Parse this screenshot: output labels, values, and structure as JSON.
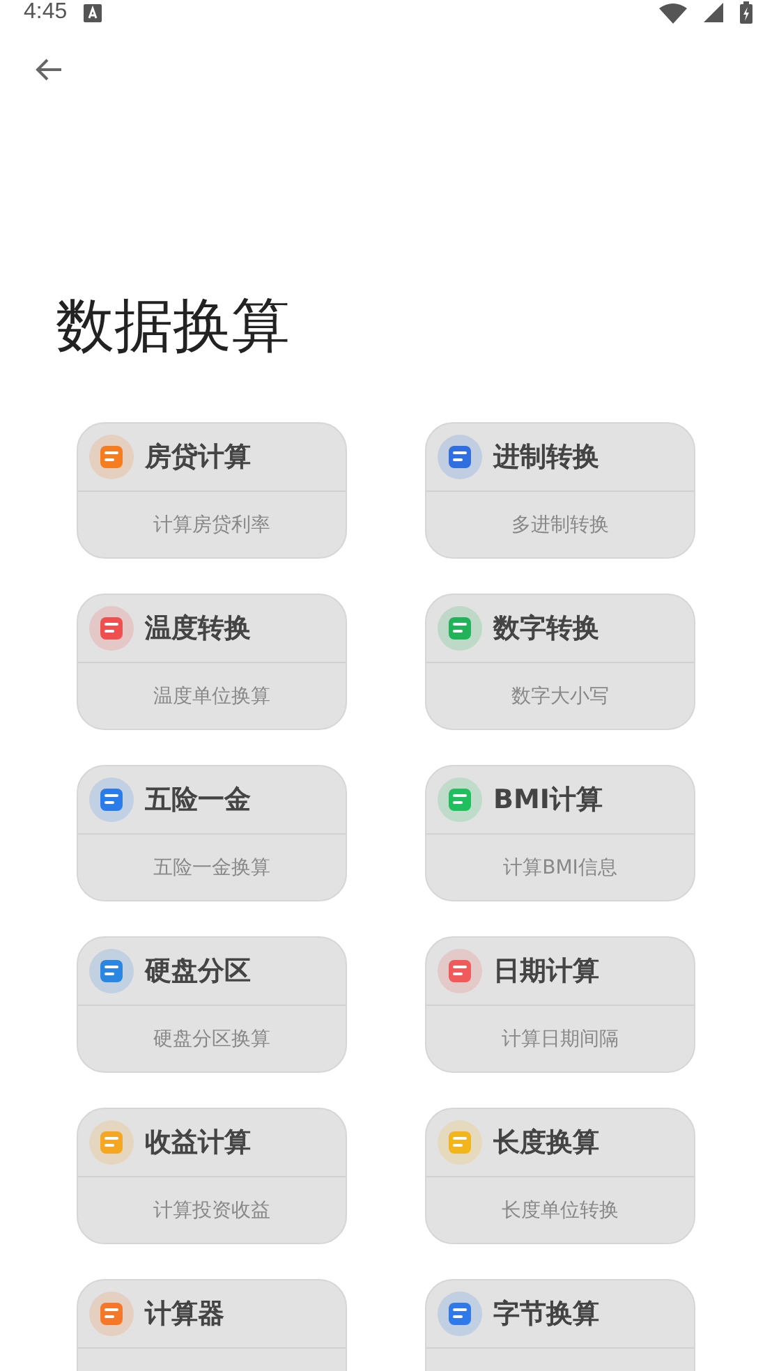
{
  "status_bar": {
    "time": "4:45"
  },
  "title": "数据换算",
  "tools": [
    {
      "name": "房贷计算",
      "description": "计算房贷利率",
      "color": "#f57c1f"
    },
    {
      "name": "进制转换",
      "description": "多进制转换",
      "color": "#2f6fe0"
    },
    {
      "name": "温度转换",
      "description": "温度单位换算",
      "color": "#ee5050"
    },
    {
      "name": "数字转换",
      "description": "数字大小写",
      "color": "#22b35a"
    },
    {
      "name": "五险一金",
      "description": "五险一金换算",
      "color": "#2a7de8"
    },
    {
      "name": "BMI计算",
      "description": "计算BMI信息",
      "color": "#1fbf5e"
    },
    {
      "name": "硬盘分区",
      "description": "硬盘分区换算",
      "color": "#2a86e0"
    },
    {
      "name": "日期计算",
      "description": "计算日期间隔",
      "color": "#f05a5a"
    },
    {
      "name": "收益计算",
      "description": "计算投资收益",
      "color": "#f5a623"
    },
    {
      "name": "长度换算",
      "description": "长度单位转换",
      "color": "#f2b51c"
    },
    {
      "name": "计算器",
      "color": "#f5782a"
    },
    {
      "name": "字节换算",
      "color": "#2f7ae8"
    }
  ]
}
